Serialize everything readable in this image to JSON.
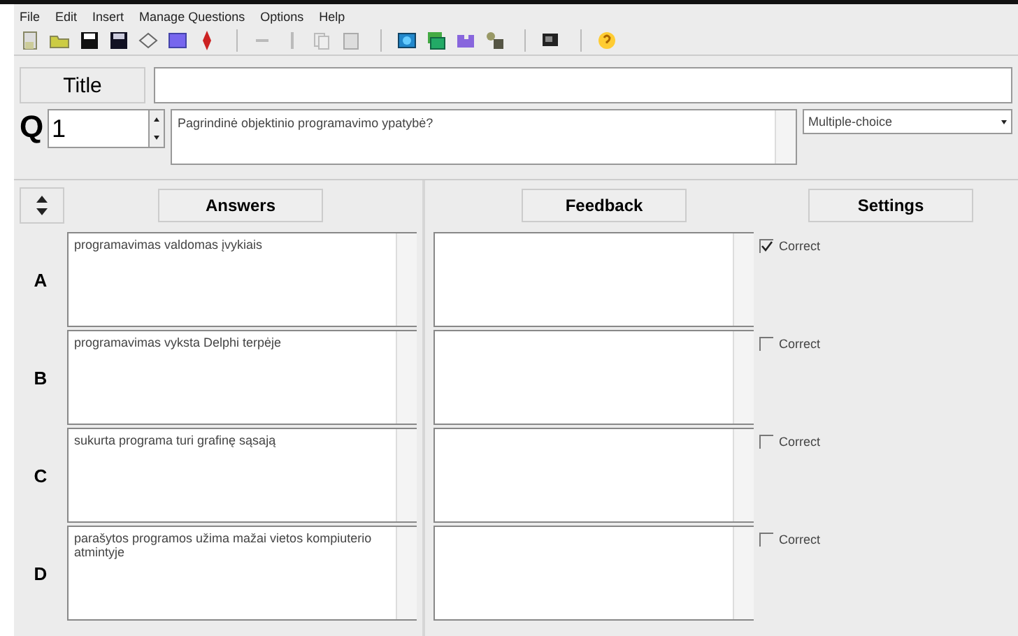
{
  "menu": [
    "File",
    "Edit",
    "Insert",
    "Manage Questions",
    "Options",
    "Help"
  ],
  "title_row": {
    "label": "Title"
  },
  "question": {
    "prefix": "Q",
    "number": "1",
    "text": "Pagrindinė objektinio programavimo ypatybė?",
    "type": "Multiple-choice"
  },
  "headers": {
    "answers": "Answers",
    "feedback": "Feedback",
    "settings": "Settings"
  },
  "answers": [
    {
      "letter": "A",
      "text": "programavimas valdomas įvykiais",
      "correct_label": "Correct",
      "checked": true
    },
    {
      "letter": "B",
      "text": "programavimas vyksta Delphi terpėje",
      "correct_label": "Correct",
      "checked": false
    },
    {
      "letter": "C",
      "text": "sukurta programa turi grafinę sąsają",
      "correct_label": "Correct",
      "checked": false
    },
    {
      "letter": "D",
      "text": "parašytos programos užima mažai vietos kompiuterio atmintyje",
      "correct_label": "Correct",
      "checked": false
    }
  ]
}
